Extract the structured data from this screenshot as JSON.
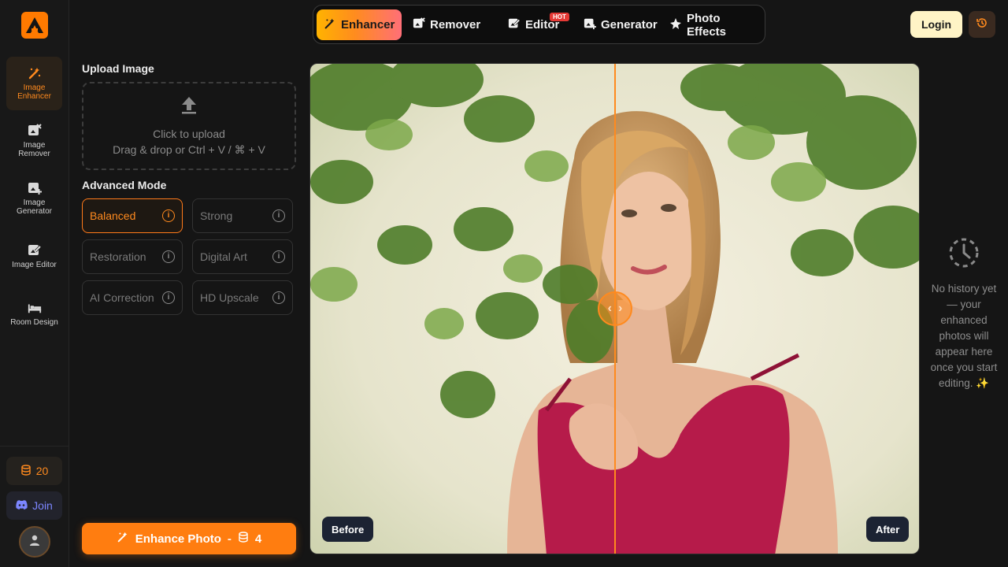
{
  "nav": {
    "tabs": [
      {
        "label": "Enhancer",
        "active": true
      },
      {
        "label": "Remover",
        "active": false
      },
      {
        "label": "Editor",
        "active": false,
        "badge": "HOT"
      },
      {
        "label": "Generator",
        "active": false
      },
      {
        "label": "Photo Effects",
        "active": false
      }
    ],
    "login_label": "Login"
  },
  "sidebar": {
    "items": [
      {
        "label": "Image Enhancer",
        "icon": "magic-wand-icon",
        "active": true
      },
      {
        "label": "Image Remover",
        "icon": "image-remove-icon"
      },
      {
        "label": "Image Generator",
        "icon": "image-add-icon"
      },
      {
        "label": "Image Editor",
        "icon": "image-edit-icon"
      },
      {
        "label": "Room Design",
        "icon": "bed-icon"
      }
    ],
    "credits": "20",
    "join_label": "Join"
  },
  "upload": {
    "title": "Upload Image",
    "line1": "Click to upload",
    "line2": "Drag & drop or Ctrl + V / ⌘ + V"
  },
  "advanced": {
    "title": "Advanced Mode",
    "modes": [
      {
        "label": "Balanced",
        "active": true
      },
      {
        "label": "Strong"
      },
      {
        "label": "Restoration"
      },
      {
        "label": "Digital Art"
      },
      {
        "label": "AI Correction"
      },
      {
        "label": "HD Upscale"
      }
    ]
  },
  "enhance_button": {
    "label": "Enhance Photo",
    "separator": "-",
    "cost": "4"
  },
  "viewer": {
    "before_label": "Before",
    "after_label": "After"
  },
  "history": {
    "empty_message": "No history yet — your enhanced photos will appear here once you start editing. ✨"
  },
  "colors": {
    "accent": "#ff7d10",
    "background": "#151515",
    "login_bg": "#fff4c6"
  }
}
